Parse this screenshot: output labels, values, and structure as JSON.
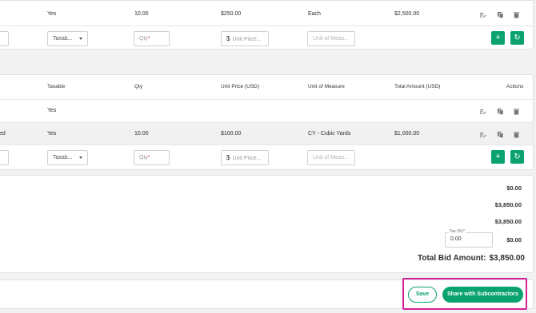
{
  "table1": {
    "row": {
      "taxable": "Yes",
      "qty": "10.00",
      "unit_price": "$250.00",
      "unit": "Each",
      "total": "$2,500.00"
    },
    "new_row": {
      "taxable_placeholder": "Taxab...",
      "qty_placeholder": "Qty",
      "qty_required": "*",
      "currency": "$",
      "unit_price_placeholder": "Unit Price...",
      "uom_placeholder": "Unit of Meas..."
    }
  },
  "table2": {
    "headers": {
      "taxable": "Taxable",
      "qty": "Qty",
      "unit_price": "Unit Price (USD)",
      "uom": "Unit of Measure",
      "total": "Total Amount (USD)",
      "actions": "Actions"
    },
    "row1": {
      "taxable": "Yes"
    },
    "row2": {
      "desc_tail": "ed",
      "taxable": "Yes",
      "qty": "10.00",
      "unit_price": "$100.00",
      "uom": "CY - Cubic Yards",
      "total": "$1,000.00"
    },
    "new_row": {
      "taxable_placeholder": "Taxab...",
      "qty_placeholder": "Qty",
      "qty_required": "*",
      "currency": "$",
      "unit_price_placeholder": "Unit Price...",
      "uom_placeholder": "Unit of Meas..."
    }
  },
  "summary": {
    "line1": "$0.00",
    "line2": "$3,850.00",
    "line3": "$3,850.00",
    "tax_label": "Tax (%)*",
    "tax_value": "0.00",
    "tax_amount": "$0.00",
    "total_label": "Total Bid Amount:",
    "total_value": "$3,850.00"
  },
  "footer": {
    "save_label": "Save",
    "share_label": "Share with Subcontractors"
  },
  "colors": {
    "accent": "#0aa36e",
    "highlight": "#d2219a"
  }
}
